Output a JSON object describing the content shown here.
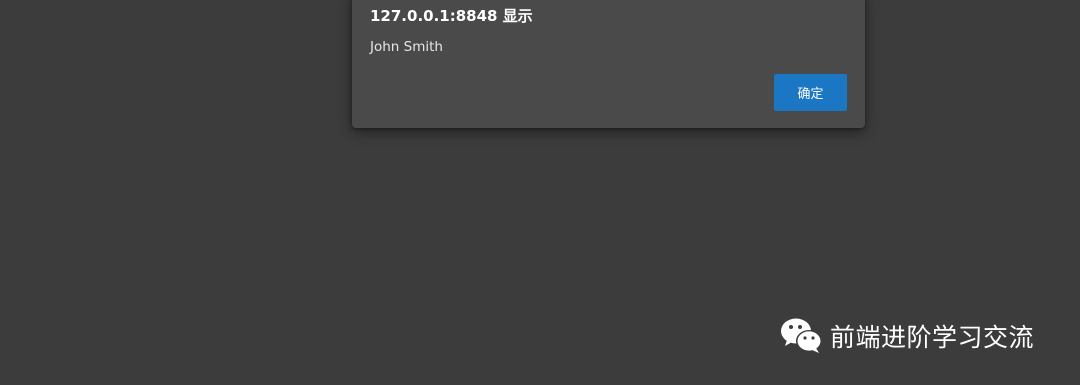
{
  "dialog": {
    "title": "127.0.0.1:8848 显示",
    "message": "John Smith",
    "ok_label": "确定"
  },
  "watermark": {
    "icon": "wechat-icon",
    "text": "前端进阶学习交流"
  },
  "colors": {
    "background": "#3d3d3d",
    "dialog_background": "#4a4a4a",
    "button_accent": "#1b76c4",
    "text": "#ffffff"
  }
}
